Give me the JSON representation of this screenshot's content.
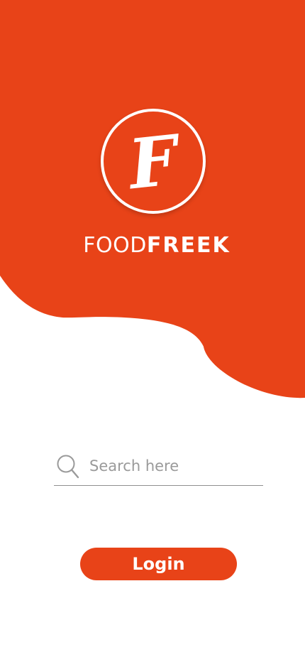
{
  "colors": {
    "brand_orange": "#e84318",
    "white": "#ffffff",
    "placeholder_grey": "#9a9a9a",
    "underline_grey": "#8f8f8f"
  },
  "logo": {
    "letter": "F"
  },
  "brand": {
    "name_light": "FOOD",
    "name_bold": "FREEK"
  },
  "search": {
    "icon": "search-icon",
    "placeholder": "Search here",
    "value": ""
  },
  "login": {
    "label": "Login"
  }
}
